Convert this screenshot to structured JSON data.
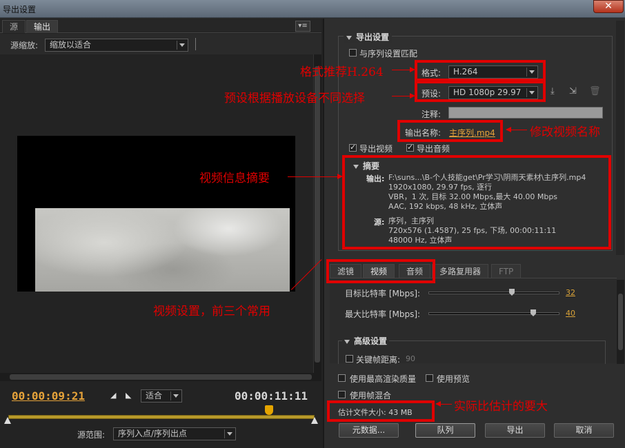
{
  "window": {
    "title": "导出设置",
    "close_label": "✕"
  },
  "left": {
    "tabs": [
      {
        "label": "源"
      },
      {
        "label": "输出"
      }
    ],
    "panel_menu": "▾≡",
    "source_zoom_label": "源缩放:",
    "source_zoom_value": "缩放以适合",
    "timecode_current": "00:00:09:21",
    "timecode_total": "00:00:11:11",
    "fit_value": "适合",
    "source_range_label": "源范围:",
    "source_range_value": "序列入点/序列出点"
  },
  "export_settings": {
    "heading": "导出设置",
    "match_sequence_label": "与序列设置匹配",
    "format_label": "格式:",
    "format_value": "H.264",
    "preset_label": "预设:",
    "preset_value": "HD 1080p 29.97",
    "comment_label": "注释:",
    "output_name_label": "输出名称:",
    "output_name_value": "主序列.mp4",
    "export_video_label": "导出视频",
    "export_audio_label": "导出音频",
    "summary": {
      "heading": "摘要",
      "output_key": "输出:",
      "output_lines": [
        "F:\\suns...\\B-个人技能get\\Pr学习\\阴雨天素材\\主序列.mp4",
        "1920x1080, 29.97 fps, 逐行",
        "VBR，1 次, 目标 32.00 Mbps,最大 40.00  Mbps",
        "AAC, 192 kbps, 48 kHz, 立体声"
      ],
      "source_key": "源:",
      "source_lines": [
        "序列，主序列",
        "720x576 (1.4587), 25 fps, 下场, 00:00:11:11",
        "48000 Hz, 立体声"
      ]
    }
  },
  "tabs2": [
    {
      "label": "滤镜"
    },
    {
      "label": "视频"
    },
    {
      "label": "音频"
    },
    {
      "label": "多路复用器"
    },
    {
      "label": "FTP"
    }
  ],
  "video": {
    "target_bitrate_label": "目标比特率 [Mbps]:",
    "target_bitrate_value": "32",
    "target_bitrate": 32,
    "max_bitrate_label": "最大比特率 [Mbps]:",
    "max_bitrate_value": "40",
    "max_bitrate": 40,
    "advanced_heading": "高级设置",
    "keyframe_label": "关键帧距离:",
    "keyframe_value": "90"
  },
  "bottom": {
    "max_quality_label": "使用最高渲染质量",
    "use_preview_label": "使用预览",
    "frame_blend_label": "使用帧混合",
    "file_size_label": "估计文件大小: 43 MB",
    "buttons": {
      "metadata": "元数据...",
      "queue": "队列",
      "export": "导出",
      "cancel": "取消"
    }
  },
  "annotations": {
    "format": "格式推荐H.264",
    "preset": "预设根据播放设备不同选择",
    "output_name": "修改视频名称",
    "summary": "视频信息摘要",
    "tabs": "视频设置，前三个常用",
    "file_size": "实际比估计的要大"
  }
}
